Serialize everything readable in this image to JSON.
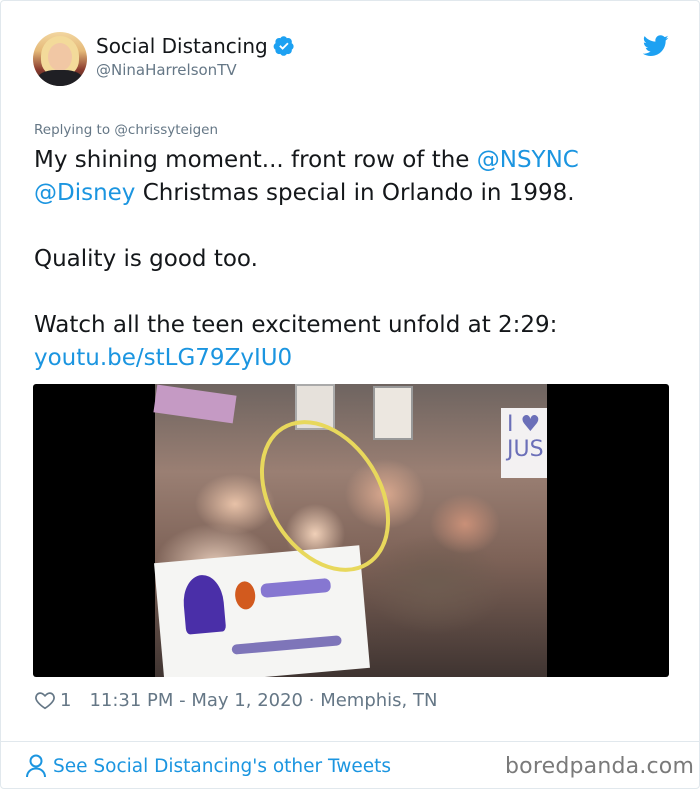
{
  "tweet": {
    "author_name": "Social Distancing",
    "author_handle": "@NinaHarrelsonTV",
    "replying_to": "Replying to @chrissyteigen",
    "lines": [
      {
        "before": "My shining moment... front row of the ",
        "link": "@NSYNC",
        "after": ""
      },
      {
        "before": "",
        "link": "@Disney",
        "after": " Christmas special in Orlando in 1998."
      },
      {
        "before": "",
        "link": "",
        "after": ""
      },
      {
        "before": "Quality is good too.",
        "link": "",
        "after": ""
      },
      {
        "before": "",
        "link": "",
        "after": ""
      },
      {
        "before": "Watch all the teen excitement unfold at 2:29:",
        "link": "",
        "after": ""
      },
      {
        "before": "",
        "link": "youtu.be/stLG79ZyIU0",
        "after": ""
      }
    ],
    "media": {
      "sign_right_text": "I ♥ JUS"
    },
    "likes": "1",
    "timestamp": "11:31 PM - May 1, 2020",
    "location": "Memphis, TN",
    "footer_link": "See Social Distancing's other Tweets"
  },
  "watermark": "boredpanda.com",
  "icons": {
    "verified": "verified-badge-icon",
    "bird": "twitter-bird-icon",
    "heart": "heart-icon",
    "person": "person-icon"
  },
  "colors": {
    "link": "#1b95e0",
    "muted": "#657786",
    "text": "#14171a"
  }
}
